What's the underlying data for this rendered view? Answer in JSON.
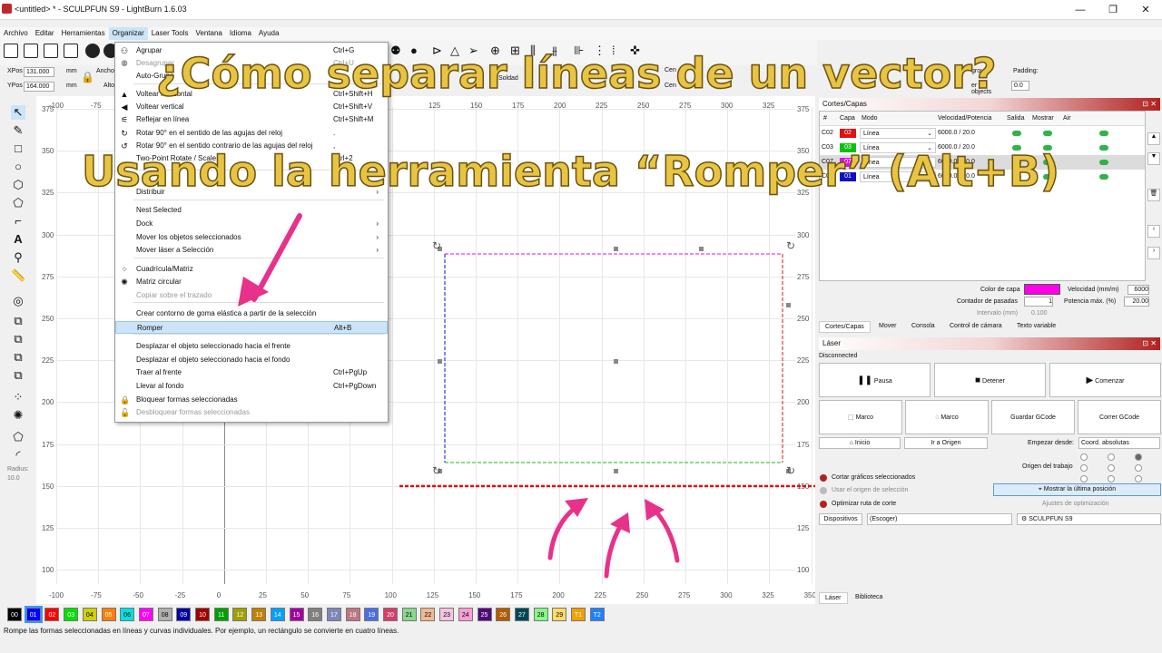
{
  "window": {
    "title": "<untitled> * - SCULPFUN S9 - LightBurn 1.6.03",
    "controls": [
      "—",
      "❐",
      "✕"
    ]
  },
  "menubar": [
    "Archivo",
    "Editar",
    "Herramientas",
    "Organizar",
    "Laser Tools",
    "Ventana",
    "Idioma",
    "Ayuda"
  ],
  "position": {
    "xpos_label": "XPos",
    "xpos_value": "131.000",
    "ypos_label": "YPos",
    "ypos_value": "164.000",
    "unit": "mm",
    "width_label": "Ancho",
    "height_label": "Alto",
    "padding_label": "Padding:",
    "padding_value": "0.0",
    "group_label": "group",
    "object_label": "er objects",
    "center_label1": "Cen",
    "center_label2": "Cen",
    "solder_label": "Soldad"
  },
  "menu": {
    "items": [
      {
        "label": "Agrupar",
        "shortcut": "Ctrl+G",
        "icon": "group-icon",
        "disabled": false
      },
      {
        "label": "Desagrupar",
        "shortcut": "Ctrl+U",
        "icon": "ungroup-icon",
        "disabled": true
      },
      {
        "label": "Auto-Grupo",
        "shortcut": "",
        "icon": "",
        "disabled": false
      },
      {
        "label": "Voltear horizontal",
        "shortcut": "Ctrl+Shift+H",
        "icon": "flip-h-icon",
        "disabled": false
      },
      {
        "label": "Voltear vertical",
        "shortcut": "Ctrl+Shift+V",
        "icon": "flip-v-icon",
        "disabled": false
      },
      {
        "label": "Reflejar en línea",
        "shortcut": "Ctrl+Shift+M",
        "icon": "mirror-icon",
        "disabled": false
      },
      {
        "label": "Rotar 90° en el sentido de las agujas del reloj",
        "shortcut": ".",
        "icon": "rotate-cw-icon",
        "disabled": false
      },
      {
        "label": "Rotar 90° en el sentido contrario de las agujas del reloj",
        "shortcut": ",",
        "icon": "rotate-ccw-icon",
        "disabled": false
      },
      {
        "label": "Two-Point Rotate / Scale",
        "shortcut": "Ctrl+2",
        "icon": "",
        "disabled": false
      },
      {
        "label": "Distribuir",
        "shortcut": "",
        "icon": "",
        "disabled": false,
        "submenu": true
      },
      {
        "label": "Nest Selected",
        "shortcut": "",
        "icon": "",
        "disabled": false
      },
      {
        "label": "Dock",
        "shortcut": "",
        "icon": "",
        "disabled": false,
        "submenu": true
      },
      {
        "label": "Mover los objetos seleccionados",
        "shortcut": "",
        "icon": "",
        "disabled": false,
        "submenu": true
      },
      {
        "label": "Mover láser a Selección",
        "shortcut": "",
        "icon": "",
        "disabled": false,
        "submenu": true
      },
      {
        "label": "Cuadrícula/Matriz",
        "shortcut": "",
        "icon": "grid-array-icon",
        "disabled": false
      },
      {
        "label": "Matriz circular",
        "shortcut": "",
        "icon": "circular-array-icon",
        "disabled": false
      },
      {
        "label": "Copiar sobre el trazado",
        "shortcut": "",
        "icon": "",
        "disabled": true
      },
      {
        "label": "Crear contorno de goma elástica a partir de la selección",
        "shortcut": "",
        "icon": "",
        "disabled": false
      },
      {
        "label": "Romper",
        "shortcut": "Alt+B",
        "icon": "",
        "disabled": false,
        "selected": true
      },
      {
        "label": "Desplazar el objeto seleccionado hacia el frente",
        "shortcut": "",
        "icon": "",
        "disabled": false
      },
      {
        "label": "Desplazar el objeto seleccionado hacia el fondo",
        "shortcut": "",
        "icon": "",
        "disabled": false
      },
      {
        "label": "Traer al frente",
        "shortcut": "Ctrl+PgUp",
        "icon": "",
        "disabled": false
      },
      {
        "label": "Llevar al fondo",
        "shortcut": "Ctrl+PgDown",
        "icon": "",
        "disabled": false
      },
      {
        "label": "Bloquear formas seleccionadas",
        "shortcut": "",
        "icon": "lock-icon",
        "disabled": false
      },
      {
        "label": "Desbloquear formas seleccionadas",
        "shortcut": "",
        "icon": "unlock-icon",
        "disabled": true
      }
    ]
  },
  "canvas": {
    "x_ticks": [
      "-100",
      "-75",
      "-50",
      "-25",
      "0",
      "25",
      "50",
      "75",
      "100",
      "125",
      "150",
      "175",
      "200",
      "225",
      "250",
      "275",
      "300",
      "325",
      "350"
    ],
    "y_ticks": [
      "375",
      "350",
      "325",
      "300",
      "275",
      "250",
      "225",
      "200",
      "175",
      "150",
      "125",
      "100"
    ],
    "top_ticks": [
      "-100",
      "-75",
      "125",
      "150",
      "175",
      "200",
      "225",
      "250",
      "275",
      "300",
      "325",
      "350"
    ]
  },
  "left_tools": {
    "radius_label": "Radius:",
    "radius_value": "10.0"
  },
  "layers_panel": {
    "title": "Cortes/Capas",
    "columns": [
      "#",
      "Capa",
      "Modo",
      "Velocidad/Potencia",
      "Salida",
      "Mostrar",
      "Air"
    ],
    "rows": [
      {
        "id": "C02",
        "layer": "02",
        "color": "#e01010",
        "mode": "Línea",
        "speed": "6000.0 / 20.0"
      },
      {
        "id": "C03",
        "layer": "03",
        "color": "#10c010",
        "mode": "Línea",
        "speed": "6000.0 / 20.0"
      },
      {
        "id": "C07",
        "layer": "07",
        "color": "#e010e0",
        "mode": "Línea",
        "speed": "6000.0 / 20.0"
      },
      {
        "id": "C01",
        "layer": "01",
        "color": "#1010c0",
        "mode": "Línea",
        "speed": "6000.0 / 20.0"
      }
    ],
    "layer_color_label": "Color de capa",
    "layer_color": "#ff00e6",
    "speed_label": "Velocidad (mm/m)",
    "speed_value": "6000",
    "pass_label": "Contador de pasadas",
    "pass_value": "1",
    "power_label": "Potencia máx. (%)",
    "power_value": "20.00",
    "interval_label": "Intervalo (mm)",
    "interval_value": "0.100",
    "tabs": [
      "Cortes/Capas",
      "Mover",
      "Consola",
      "Control de cámara",
      "Texto variable"
    ]
  },
  "laser_panel": {
    "title": "Láser",
    "status": "Disconnected",
    "pause": "Pausa",
    "stop": "Detener",
    "start": "Comenzar",
    "frame1": "Marco",
    "frame2": "Marco",
    "save_gcode": "Guardar GCode",
    "run_gcode": "Correr GCode",
    "home": "Inicio",
    "go_origin": "Ir a Origen",
    "start_from_label": "Empezar desde:",
    "start_from_value": "Coord. absolutas",
    "job_origin_label": "Origen del trabajo",
    "cut_selected": "Cortar gráficos seleccionados",
    "use_origin": "Usar el origen de selección",
    "show_last": "Mostrar la última posición",
    "optimize": "Optimizar ruta de corte",
    "optimize_settings": "Ajustes de optimización",
    "devices": "Dispositivos",
    "choose": "(Escoger)",
    "device_name": "SCULPFUN S9",
    "tabs": [
      "Láser",
      "Biblioteca"
    ]
  },
  "palette": [
    "00",
    "01",
    "02",
    "03",
    "04",
    "05",
    "06",
    "07",
    "08",
    "09",
    "10",
    "11",
    "12",
    "13",
    "14",
    "15",
    "16",
    "17",
    "18",
    "19",
    "20",
    "21",
    "22",
    "23",
    "24",
    "25",
    "26",
    "27",
    "28",
    "29",
    "T1",
    "T2"
  ],
  "palette_colors": [
    "#000000",
    "#0000ff",
    "#ff0000",
    "#00e000",
    "#d0d000",
    "#ff8000",
    "#00e0e0",
    "#ff00ff",
    "#b0b0b0",
    "#0000a0",
    "#a00000",
    "#00a000",
    "#a0a000",
    "#c08000",
    "#00a0ff",
    "#a000a0",
    "#808080",
    "#7d87b9",
    "#bb7784",
    "#4a6fe3",
    "#d33f6a",
    "#8cd78c",
    "#f0b98d",
    "#f6c4e1",
    "#fa9ed4",
    "#500a78",
    "#b45a00",
    "#004754",
    "#86fa88",
    "#ffdb66",
    "#f0a000",
    "#2080ff"
  ],
  "statusbar": "Rompe las formas seleccionadas en líneas y curvas individuales. Por ejemplo, un rectángulo se convierte en cuatro líneas.",
  "overlay": {
    "line1": "¿Cómo separar líneas de un vector?",
    "line2": "Usando la herramienta “Romper” (Alt+B)"
  }
}
